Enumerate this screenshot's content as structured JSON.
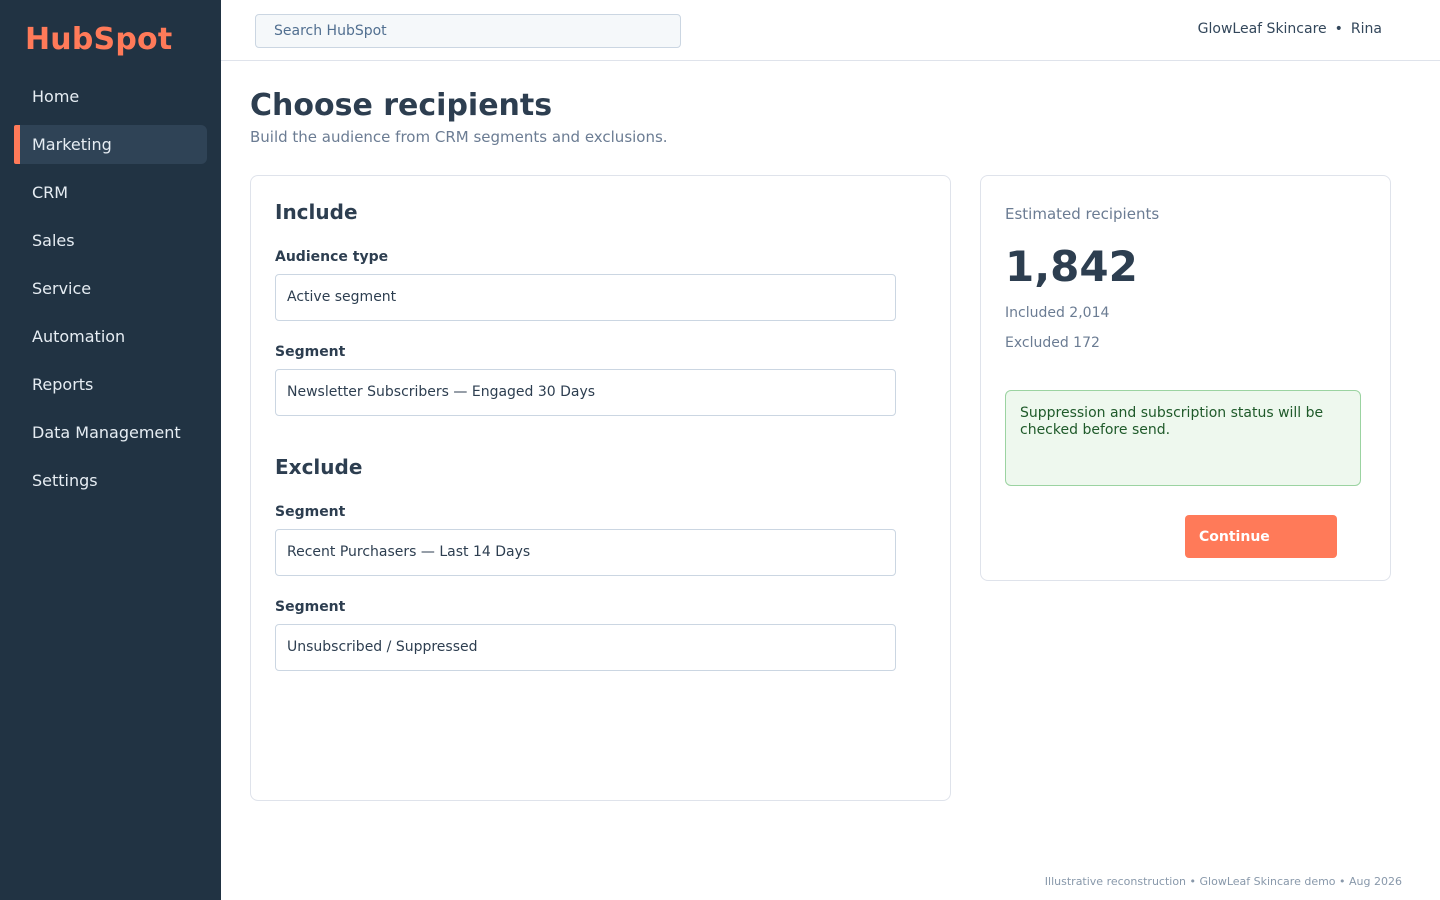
{
  "brand": {
    "logo": "HubSpot",
    "accent": "#ff7a59",
    "sidebar_bg": "#213343"
  },
  "sidebar": {
    "items": [
      {
        "label": "Home",
        "active": false
      },
      {
        "label": "Marketing",
        "active": true
      },
      {
        "label": "CRM",
        "active": false
      },
      {
        "label": "Sales",
        "active": false
      },
      {
        "label": "Service",
        "active": false
      },
      {
        "label": "Automation",
        "active": false
      },
      {
        "label": "Reports",
        "active": false
      },
      {
        "label": "Data Management",
        "active": false
      },
      {
        "label": "Settings",
        "active": false
      }
    ]
  },
  "topbar": {
    "search_placeholder": "Search HubSpot",
    "account_name": "GlowLeaf Skincare",
    "separator": "•",
    "user_name": "Rina"
  },
  "page": {
    "title": "Choose recipients",
    "subtitle": "Build the audience from CRM segments and exclusions."
  },
  "include": {
    "title": "Include",
    "audience_type_label": "Audience type",
    "audience_type_value": "Active segment",
    "segment_label": "Segment",
    "segment_value": "Newsletter Subscribers — Engaged 30 Days"
  },
  "exclude": {
    "title": "Exclude",
    "segments": [
      {
        "label": "Segment",
        "value": "Recent Purchasers — Last 14 Days"
      },
      {
        "label": "Segment",
        "value": "Unsubscribed / Suppressed"
      }
    ]
  },
  "estimate": {
    "label": "Estimated recipients",
    "count": "1,842",
    "included": "Included 2,014",
    "excluded": "Excluded 172",
    "notice": "Suppression and subscription status will be checked before send.",
    "continue_label": "Continue"
  },
  "footer": {
    "text": "Illustrative reconstruction • GlowLeaf Skincare demo • Aug 2026"
  }
}
